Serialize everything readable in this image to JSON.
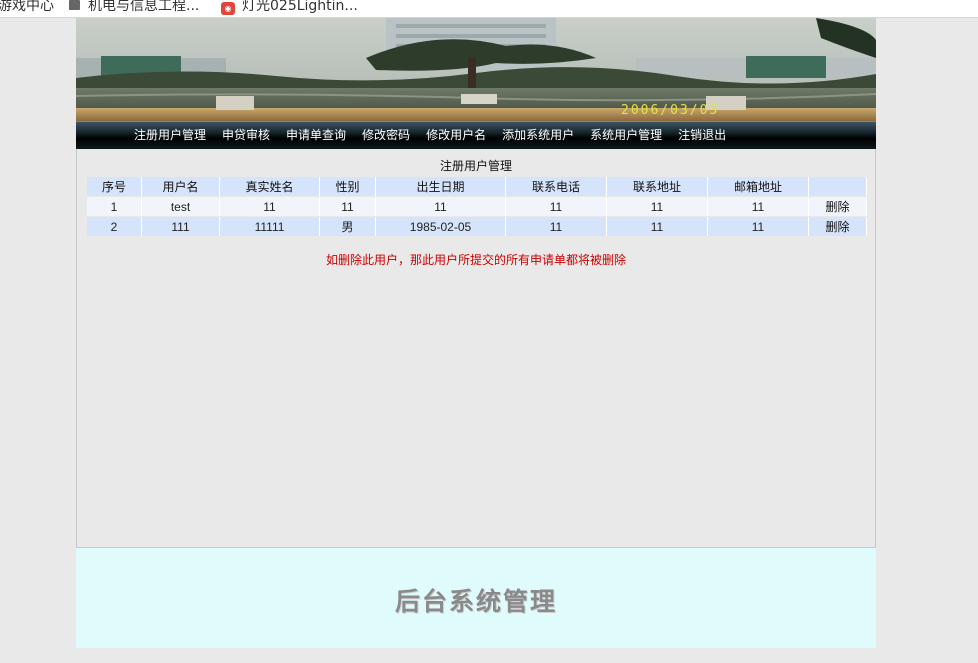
{
  "bookmarks": [
    {
      "label": "游戏中心",
      "icon": "none"
    },
    {
      "label": "机电与信息工程...",
      "icon": "folder-icon"
    },
    {
      "label": "灯光025Lightin...",
      "icon": "site-icon"
    }
  ],
  "banner": {
    "date_text": "2006/03/05"
  },
  "nav": [
    "注册用户管理",
    "申贷审核",
    "申请单查询",
    "修改密码",
    "修改用户名",
    "添加系统用户",
    "系统用户管理",
    "注销退出"
  ],
  "content": {
    "title": "注册用户管理",
    "columns": [
      "序号",
      "用户名",
      "真实姓名",
      "性别",
      "出生日期",
      "联系电话",
      "联系地址",
      "邮箱地址",
      ""
    ],
    "rows": [
      [
        "1",
        "test",
        "11",
        "11",
        "11",
        "11",
        "11",
        "11",
        "删除"
      ],
      [
        "2",
        "111",
        "11111",
        "男",
        "1985-02-05",
        "11",
        "11",
        "11",
        "删除"
      ]
    ],
    "warning": "如删除此用户，那此用户所提交的所有申请单都将被删除"
  },
  "footer": {
    "title": "后台系统管理"
  },
  "colors": {
    "header_row": "#d6e4fb",
    "warning": "#cc0000",
    "footer_bg": "#e0fbfc",
    "nav_bg": "#000000"
  }
}
